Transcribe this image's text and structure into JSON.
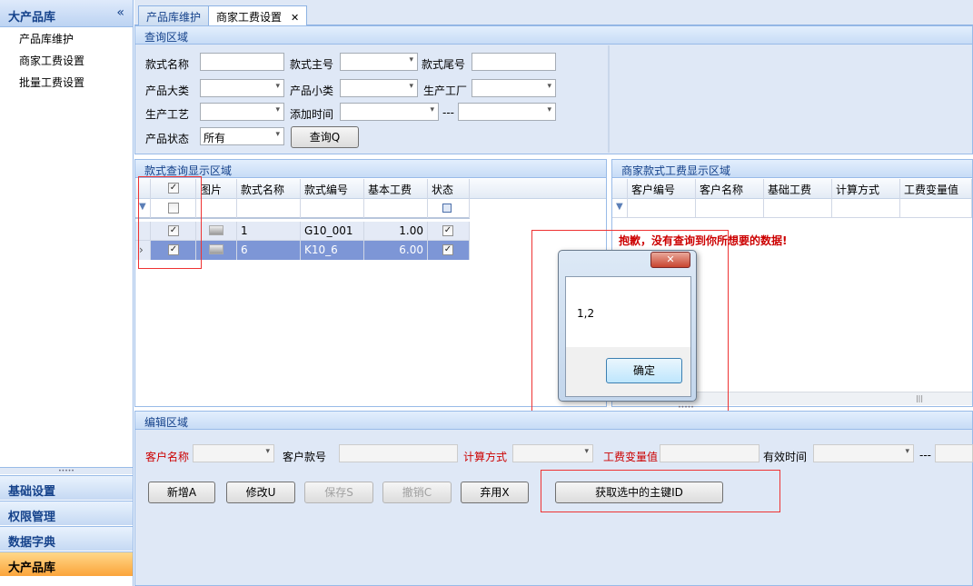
{
  "sidebar": {
    "title": "大产品库",
    "collapse": "«",
    "items": [
      "产品库维护",
      "商家工费设置",
      "批量工费设置"
    ],
    "bottom": [
      "基础设置",
      "权限管理",
      "数据字典",
      "大产品库"
    ],
    "splitter": "•••••"
  },
  "tabs": [
    {
      "label": "产品库维护"
    },
    {
      "label": "商家工费设置",
      "close": "✕"
    }
  ],
  "query": {
    "title": "查询区域",
    "name_label": "款式名称",
    "main_no_label": "款式主号",
    "tail_no_label": "款式尾号",
    "cat_label": "产品大类",
    "subcat_label": "产品小类",
    "factory_label": "生产工厂",
    "craft_label": "生产工艺",
    "time_label": "添加时间",
    "dash": "---",
    "status_label": "产品状态",
    "status_value": "所有",
    "query_btn": "查询Q"
  },
  "grid": {
    "title": "款式查询显示区域",
    "columns": [
      "图片",
      "款式名称",
      "款式编号",
      "基本工费",
      "状态"
    ],
    "rows": [
      {
        "name": "1",
        "code": "G10_001",
        "fee": "1.00"
      },
      {
        "name": "6",
        "code": "K10_6",
        "fee": "6.00"
      }
    ],
    "check": "✓",
    "row_marker": "›"
  },
  "right_grid": {
    "title": "商家款式工费显示区域",
    "columns": [
      "客户编号",
      "客户名称",
      "基础工费",
      "计算方式",
      "工费变量值"
    ],
    "no_data": "抱歉，没有查询到你所想要的数据!",
    "scroll": "|||",
    "splitter": "•••••"
  },
  "dialog": {
    "close": "✕",
    "message": "1,2",
    "ok": "确定"
  },
  "edit": {
    "title": "编辑区域",
    "customer_label": "客户名称",
    "customer_no_label": "客户款号",
    "calc_label": "计算方式",
    "var_label": "工费变量值",
    "valid_label": "有效时间",
    "dash": "---",
    "add": "新增A",
    "modify": "修改U",
    "save": "保存S",
    "undo": "撤销C",
    "discard": "弃用X",
    "get_id": "获取选中的主键ID"
  },
  "colors": {
    "header_text": "#15428b",
    "selected_row": "#7d96d6",
    "alert_red": "#cc0000",
    "nav_active": "#fba43a"
  },
  "icons": [
    "collapse-icon",
    "filter-icon",
    "image-icon",
    "close-icon",
    "row-pointer-icon",
    "dropdown-arrow-icon"
  ]
}
